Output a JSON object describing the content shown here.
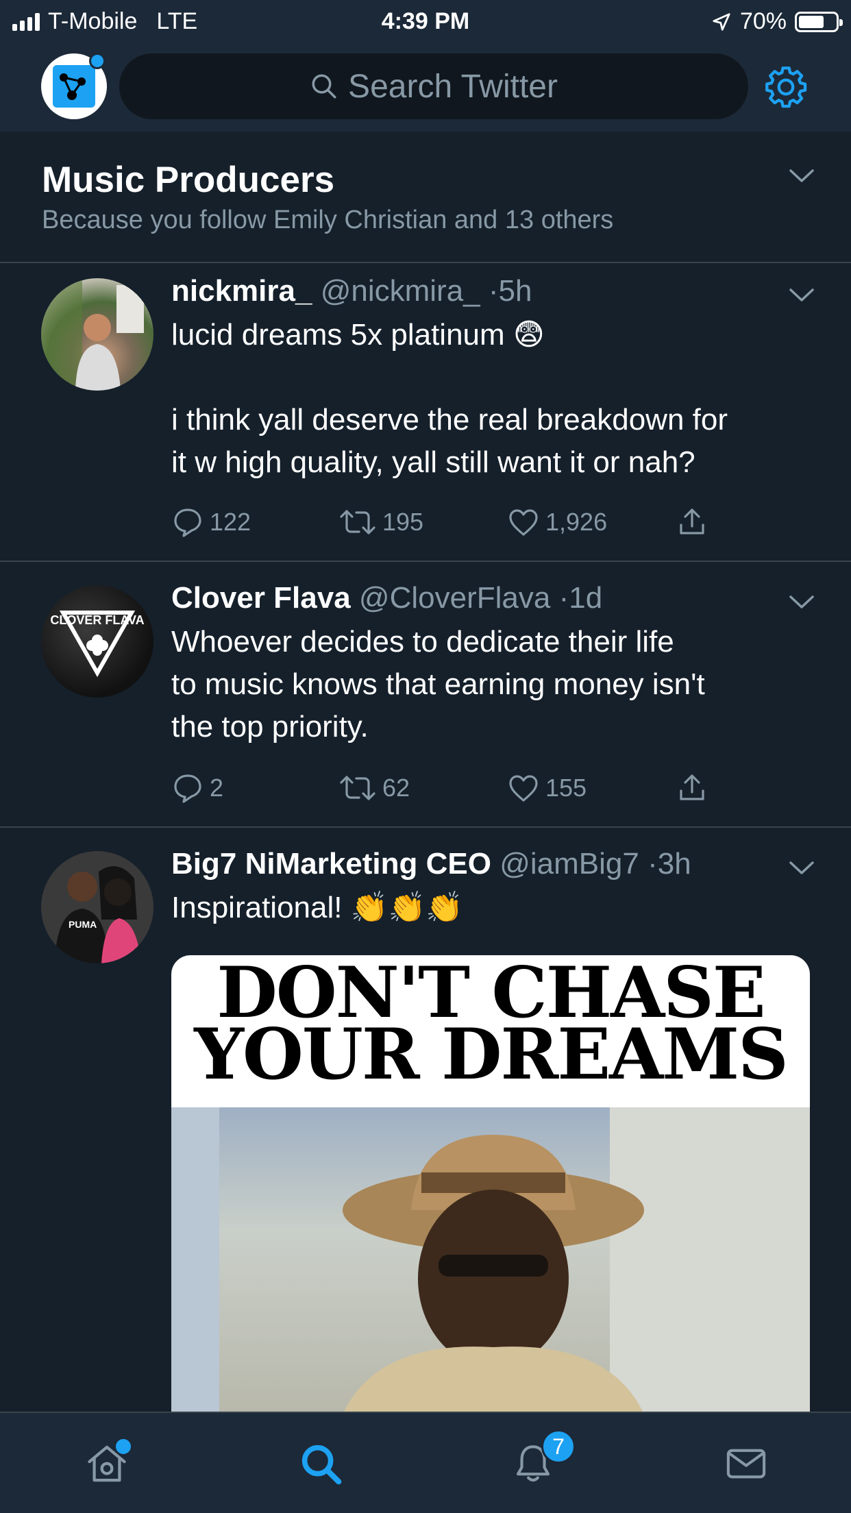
{
  "status_bar": {
    "carrier": "T-Mobile",
    "network": "LTE",
    "time": "4:39 PM",
    "battery": "70%",
    "battery_level": 0.7
  },
  "header": {
    "search_placeholder": "Search Twitter"
  },
  "topic": {
    "title": "Music Producers",
    "subtitle": "Because you follow Emily Christian and 13 others"
  },
  "tweets": [
    {
      "name": "nickmira_",
      "handle": "@nickmira_",
      "time": "5h",
      "lines": [
        "lucid dreams 5x platinum 😨",
        "",
        "i think yall deserve the real breakdown for",
        "it w high quality, yall still want it or nah?"
      ],
      "replies": "122",
      "retweets": "195",
      "likes": "1,926"
    },
    {
      "name": "Clover Flava",
      "handle": "@CloverFlava",
      "time": "1d",
      "avatar_text": "CLOVER FLAVA",
      "lines": [
        "Whoever decides to dedicate their life",
        "to music knows that earning money isn't",
        "the top priority."
      ],
      "replies": "2",
      "retweets": "62",
      "likes": "155"
    },
    {
      "name": "Big7 NiMarketing CEO",
      "handle": "@iamBig7",
      "time": "3h",
      "lines": [
        "Inspirational! 👏👏👏"
      ],
      "media_line1": "DON'T CHASE",
      "media_line2": "YOUR DREAMS"
    }
  ],
  "tabbar": {
    "notifications_count": "7"
  },
  "colors": {
    "background": "#15202b",
    "bar": "#1c2938",
    "accent": "#1da1f2",
    "secondary_text": "#8899a6"
  }
}
